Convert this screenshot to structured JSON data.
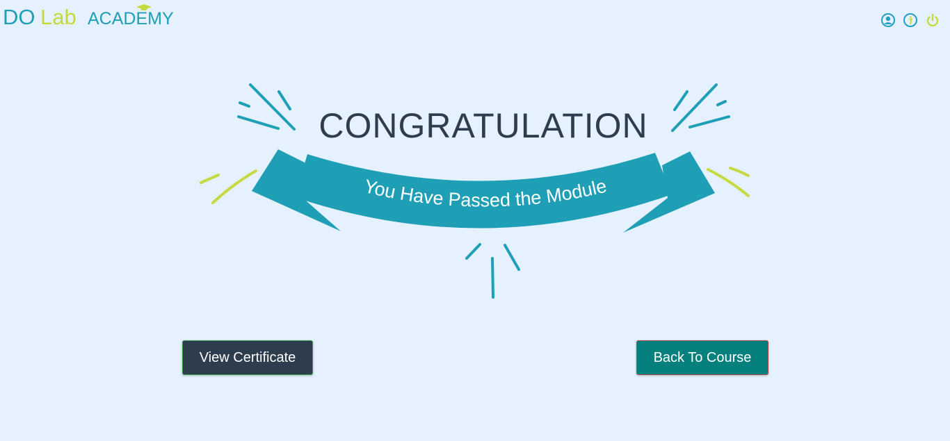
{
  "header": {
    "logo": {
      "brand_part1": "DO",
      "brand_part2": "Lab",
      "brand_part3": "ACADEMY",
      "icon": "graduation-cap-icon"
    },
    "icons": [
      {
        "name": "user-icon",
        "color": "#1fa0c4"
      },
      {
        "name": "info-icon",
        "color": "#1fa0c4"
      },
      {
        "name": "power-icon",
        "color": "#c5d93a"
      }
    ]
  },
  "celebration": {
    "heading": "CONGRATULATION",
    "ribbon_text": "You Have Passed the Module",
    "colors": {
      "heading": "#2e3d4e",
      "ribbon": "#1f9fb6",
      "accent": "#c7d940"
    }
  },
  "actions": {
    "view_certificate": "View Certificate",
    "back_to_course": "Back To Course"
  },
  "colors": {
    "background": "#e5f1fe",
    "primary_dark": "#2e3d4e",
    "teal": "#06807c"
  }
}
